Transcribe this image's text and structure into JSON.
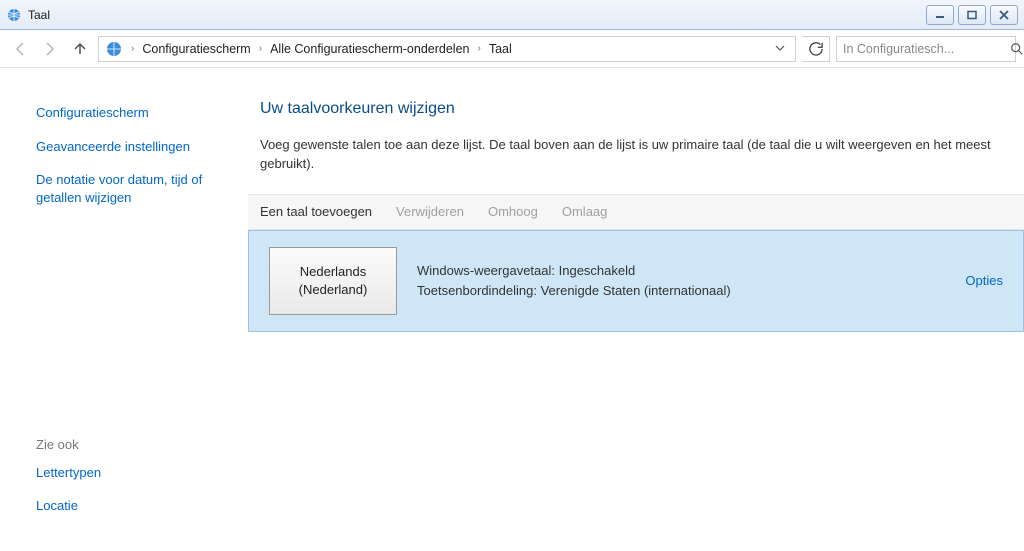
{
  "window": {
    "title": "Taal"
  },
  "breadcrumb": {
    "item0": "Configuratiescherm",
    "item1": "Alle Configuratiescherm-onderdelen",
    "item2": "Taal"
  },
  "search": {
    "placeholder": "In Configuratiesch..."
  },
  "sidebar": {
    "link0": "Configuratiescherm",
    "link1": "Geavanceerde instellingen",
    "link2": "De notatie voor datum, tijd of getallen wijzigen",
    "seeAlsoTitle": "Zie ook",
    "seeAlso0": "Lettertypen",
    "seeAlso1": "Locatie"
  },
  "main": {
    "heading": "Uw taalvoorkeuren wijzigen",
    "description": "Voeg gewenste talen toe aan deze lijst. De taal boven aan de lijst is uw primaire taal (de taal die u wilt weergeven en het meest gebruikt)."
  },
  "toolbar": {
    "add": "Een taal toevoegen",
    "remove": "Verwijderen",
    "up": "Omhoog",
    "down": "Omlaag"
  },
  "language": {
    "tileLine1": "Nederlands",
    "tileLine2": "(Nederland)",
    "detail1": "Windows-weergavetaal: Ingeschakeld",
    "detail2": "Toetsenbordindeling: Verenigde Staten (internationaal)",
    "options": "Opties"
  }
}
